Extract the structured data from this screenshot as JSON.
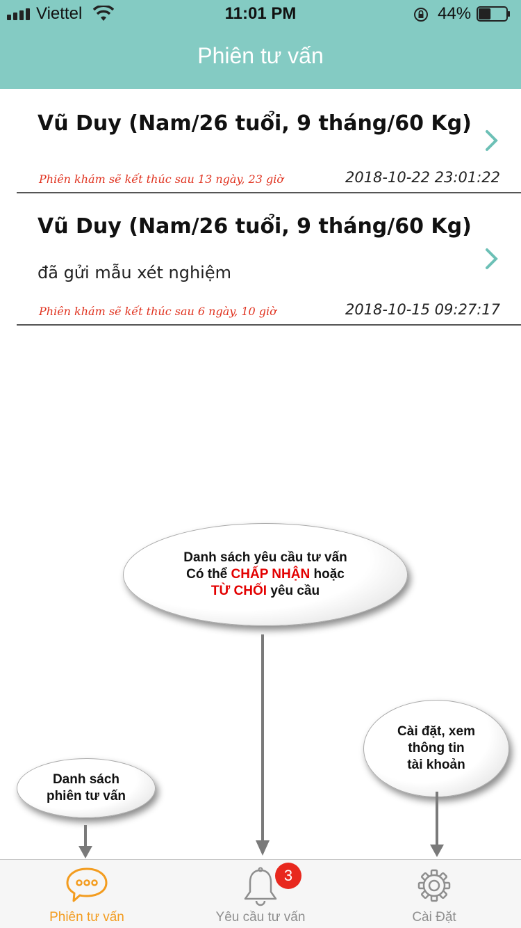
{
  "status_bar": {
    "carrier": "Viettel",
    "time": "11:01 PM",
    "battery_percent": "44%",
    "battery_level": 0.44
  },
  "header": {
    "title": "Phiên tư vấn"
  },
  "sessions": [
    {
      "name": "Vũ Duy (Nam/26 tuổi, 9 tháng/60 Kg)",
      "message": "",
      "expiry": "Phiên khám sẽ kết thúc sau 13 ngày, 23 giờ",
      "timestamp": "2018-10-22 23:01:22"
    },
    {
      "name": "Vũ Duy (Nam/26 tuổi, 9 tháng/60 Kg)",
      "message": "đã gửi mẫu xét nghiệm",
      "expiry": "Phiên khám sẽ kết thúc sau 6 ngày, 10 giờ",
      "timestamp": "2018-10-15 09:27:17"
    }
  ],
  "callouts": {
    "requests": {
      "line1": "Danh sách yêu cầu tư vấn",
      "line2_prefix": "Có thể ",
      "accept": "CHẤP NHẬN",
      "line2_suffix": " hoặc",
      "reject": "TỪ CHỐI",
      "line3_suffix": " yêu cầu"
    },
    "sessions": {
      "line1": "Danh sách",
      "line2": "phiên tư vấn"
    },
    "settings": {
      "line1": "Cài đặt, xem",
      "line2": "thông tin",
      "line3": "tài khoản"
    }
  },
  "tabs": [
    {
      "label": "Phiên tư vấn",
      "icon": "chat-bubble-icon",
      "active": true
    },
    {
      "label": "Yêu cầu tư vấn",
      "icon": "bell-icon",
      "active": false
    },
    {
      "label": "Cài Đặt",
      "icon": "gear-icon",
      "active": false
    }
  ],
  "badge": {
    "count": "3"
  },
  "colors": {
    "header_bg": "#84cbc3",
    "accent": "#f39c1f",
    "chevron": "#6cc0b6",
    "warning_text": "#e0321f",
    "badge": "#e8281e"
  }
}
